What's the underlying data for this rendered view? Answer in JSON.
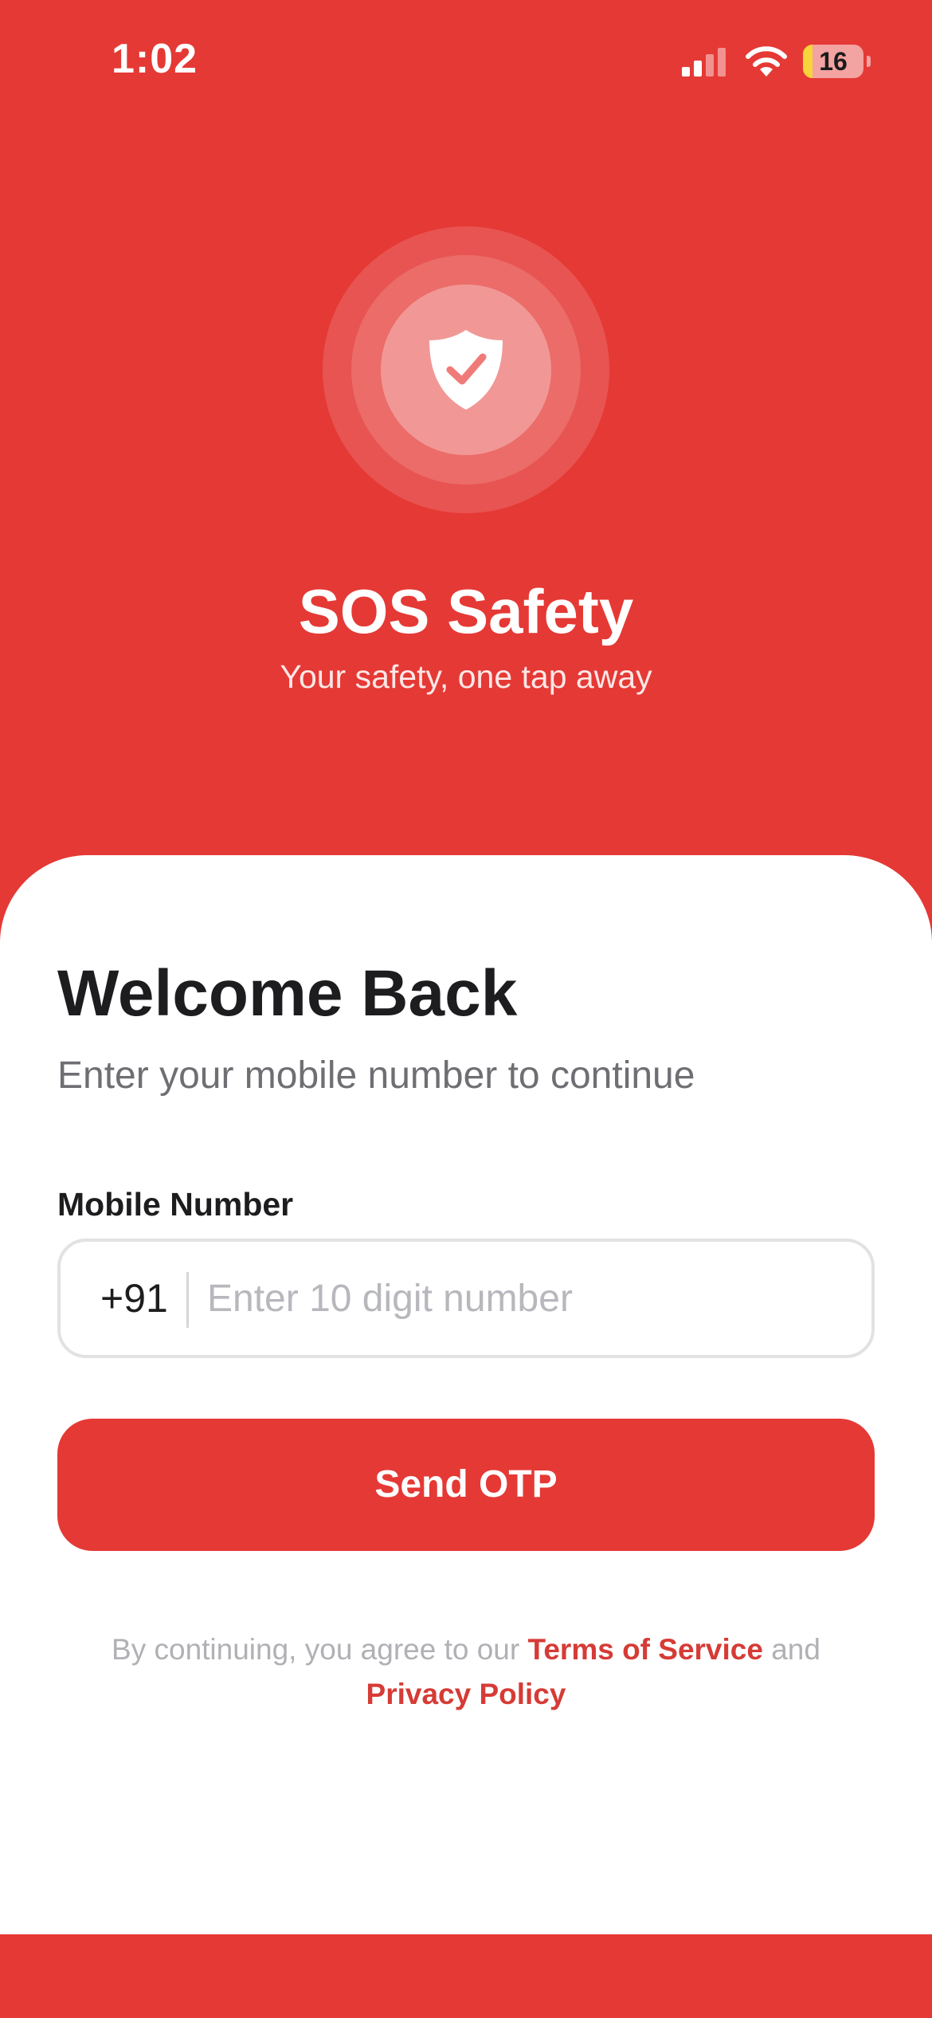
{
  "status_bar": {
    "time": "1:02",
    "battery_level": "16",
    "battery_fraction": 0.16,
    "signal_icon": "cellular-signal-icon",
    "wifi_icon": "wifi-icon",
    "battery_icon": "battery-icon"
  },
  "hero": {
    "logo_icon": "shield-check-icon",
    "title": "SOS Safety",
    "tagline": "Your safety, one tap away"
  },
  "login": {
    "title": "Welcome Back",
    "subtitle": "Enter your mobile number to continue",
    "mobile_label": "Mobile Number",
    "country_code": "+91",
    "mobile_placeholder": "Enter 10 digit number",
    "mobile_value": "",
    "send_button": "Send OTP"
  },
  "legal": {
    "prefix": "By continuing, you agree to our ",
    "terms": "Terms of Service",
    "conjunction": " and",
    "privacy": "Privacy Policy"
  },
  "colors": {
    "brand_red": "#e53935",
    "link_red": "#d63b36",
    "battery_low_yellow": "#f6d43a"
  }
}
